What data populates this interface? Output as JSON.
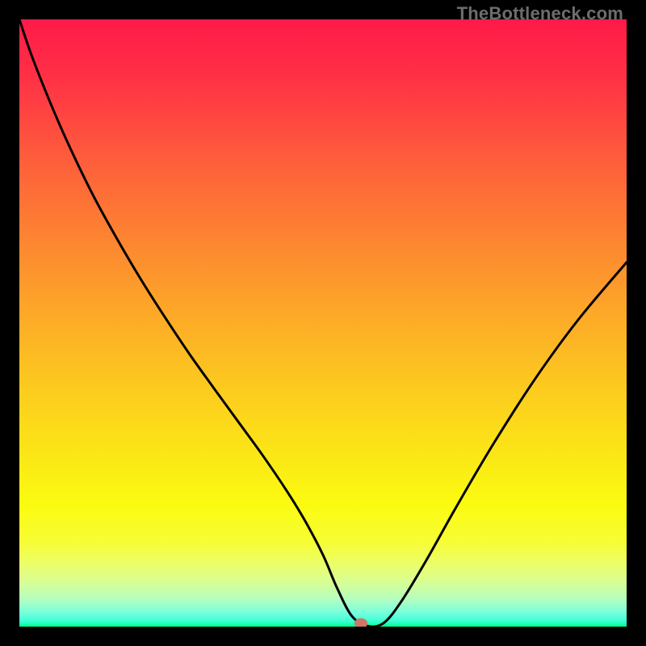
{
  "watermark": "TheBottleneck.com",
  "chart_data": {
    "type": "line",
    "title": "",
    "xlabel": "",
    "ylabel": "",
    "xlim": [
      0,
      100
    ],
    "ylim": [
      0,
      100
    ],
    "grid": false,
    "legend": false,
    "background_gradient": {
      "stops": [
        {
          "offset": 0.0,
          "color": "#ff1a49"
        },
        {
          "offset": 0.1,
          "color": "#ff3245"
        },
        {
          "offset": 0.22,
          "color": "#fe5a3c"
        },
        {
          "offset": 0.35,
          "color": "#fd8132"
        },
        {
          "offset": 0.48,
          "color": "#fda728"
        },
        {
          "offset": 0.6,
          "color": "#fcc91f"
        },
        {
          "offset": 0.72,
          "color": "#fbe716"
        },
        {
          "offset": 0.8,
          "color": "#fbfb10"
        },
        {
          "offset": 0.86,
          "color": "#f7fd34"
        },
        {
          "offset": 0.9,
          "color": "#eafe6e"
        },
        {
          "offset": 0.93,
          "color": "#d5fe9a"
        },
        {
          "offset": 0.955,
          "color": "#b3fec0"
        },
        {
          "offset": 0.975,
          "color": "#7dffdb"
        },
        {
          "offset": 0.99,
          "color": "#40ffd8"
        },
        {
          "offset": 1.0,
          "color": "#00ff91"
        }
      ]
    },
    "series": [
      {
        "name": "bottleneck-curve",
        "color": "#000000",
        "x": [
          0.0,
          2.0,
          5.0,
          8.0,
          12.0,
          16.0,
          20.0,
          24.0,
          28.0,
          32.0,
          36.0,
          40.0,
          44.0,
          47.0,
          50.0,
          52.3,
          54.7,
          57.3,
          60.0,
          63.0,
          67.0,
          72.0,
          78.0,
          85.0,
          92.0,
          100.0
        ],
        "y": [
          100.0,
          94.1,
          86.5,
          79.6,
          71.3,
          64.0,
          57.2,
          50.9,
          44.9,
          39.3,
          33.8,
          28.3,
          22.4,
          17.5,
          11.8,
          6.4,
          1.8,
          0.1,
          0.6,
          4.3,
          10.9,
          19.8,
          30.0,
          40.9,
          50.5,
          60.0
        ]
      }
    ],
    "marker": {
      "x": 56.2,
      "y": 0.5,
      "shape": "ellipse",
      "color": "#ce7667"
    }
  }
}
